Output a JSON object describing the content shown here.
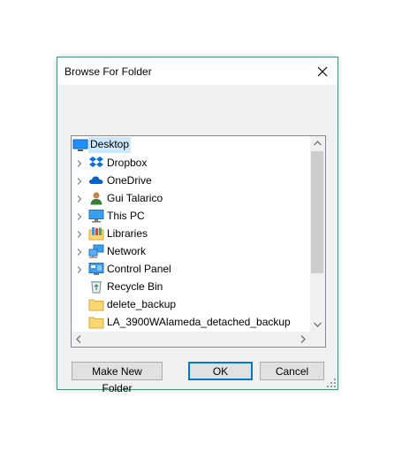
{
  "dialog": {
    "title": "Browse For Folder",
    "description": "",
    "buttons": {
      "make_new_folder": "Make New Folder",
      "ok": "OK",
      "cancel": "Cancel"
    }
  },
  "tree": {
    "items": [
      {
        "label": "Desktop",
        "icon": "desktop-icon",
        "expandable": false,
        "selected": true,
        "indent": 0
      },
      {
        "label": "Dropbox",
        "icon": "dropbox-icon",
        "expandable": true,
        "selected": false,
        "indent": 1
      },
      {
        "label": "OneDrive",
        "icon": "onedrive-cloud-icon",
        "expandable": true,
        "selected": false,
        "indent": 1
      },
      {
        "label": "Gui Talarico",
        "icon": "user-icon",
        "expandable": true,
        "selected": false,
        "indent": 1
      },
      {
        "label": "This PC",
        "icon": "computer-icon",
        "expandable": true,
        "selected": false,
        "indent": 1
      },
      {
        "label": "Libraries",
        "icon": "libraries-icon",
        "expandable": true,
        "selected": false,
        "indent": 1
      },
      {
        "label": "Network",
        "icon": "network-icon",
        "expandable": true,
        "selected": false,
        "indent": 1
      },
      {
        "label": "Control Panel",
        "icon": "control-panel-icon",
        "expandable": true,
        "selected": false,
        "indent": 1
      },
      {
        "label": "Recycle Bin",
        "icon": "recycle-bin-icon",
        "expandable": false,
        "selected": false,
        "indent": 1
      },
      {
        "label": "delete_backup",
        "icon": "folder-icon",
        "expandable": false,
        "selected": false,
        "indent": 1
      },
      {
        "label": "LA_3900WAlameda_detached_backup",
        "icon": "folder-icon",
        "expandable": false,
        "selected": false,
        "indent": 1
      }
    ]
  },
  "colors": {
    "dialog_border": "#4a8f84",
    "selection": "#cce8ff",
    "default_button_border": "#0078d7",
    "folder": "#f8d775"
  }
}
